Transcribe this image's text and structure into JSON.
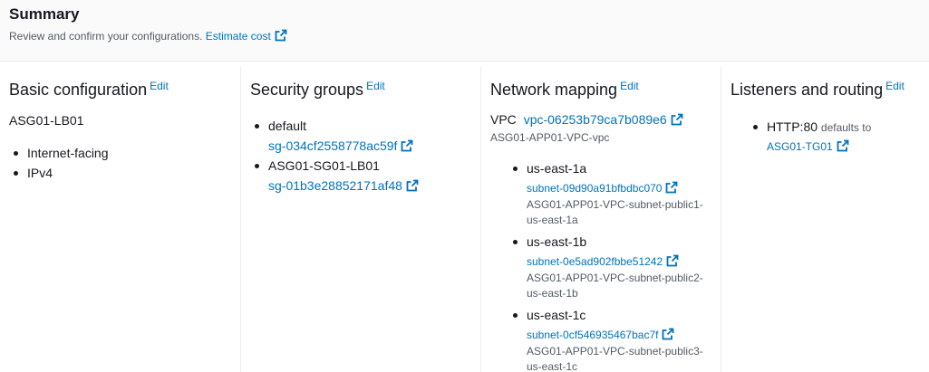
{
  "summary": {
    "title": "Summary",
    "description": "Review and confirm your configurations.",
    "estimate_link": "Estimate cost"
  },
  "edit_label": "Edit",
  "basic": {
    "title": "Basic configuration",
    "name": "ASG01-LB01",
    "items": [
      "Internet-facing",
      "IPv4"
    ]
  },
  "security": {
    "title": "Security groups",
    "groups": [
      {
        "name": "default",
        "id": "sg-034cf2558778ac59f"
      },
      {
        "name": "ASG01-SG01-LB01",
        "id": "sg-01b3e28852171af48"
      }
    ]
  },
  "network": {
    "title": "Network mapping",
    "vpc_label": "VPC",
    "vpc_id": "vpc-06253b79ca7b089e6",
    "vpc_name": "ASG01-APP01-VPC-vpc",
    "zones": [
      {
        "az": "us-east-1a",
        "subnet": "subnet-09d90a91bfbdbc070",
        "name1": "ASG01-APP01-VPC-subnet-public1-",
        "name2": "us-east-1a"
      },
      {
        "az": "us-east-1b",
        "subnet": "subnet-0e5ad902fbbe51242",
        "name1": "ASG01-APP01-VPC-subnet-public2-",
        "name2": "us-east-1b"
      },
      {
        "az": "us-east-1c",
        "subnet": "subnet-0cf546935467bac7f",
        "name1": "ASG01-APP01-VPC-subnet-public3-",
        "name2": "us-east-1c"
      }
    ]
  },
  "listeners": {
    "title": "Listeners and routing",
    "protocol": "HTTP:80",
    "defaults_to": "defaults to",
    "target": "ASG01-TG01"
  },
  "colors": {
    "link": "#0073bb",
    "text": "#16191f",
    "muted": "#545b64",
    "divider": "#eaeded"
  },
  "icons": {
    "external": "external-link-icon"
  }
}
